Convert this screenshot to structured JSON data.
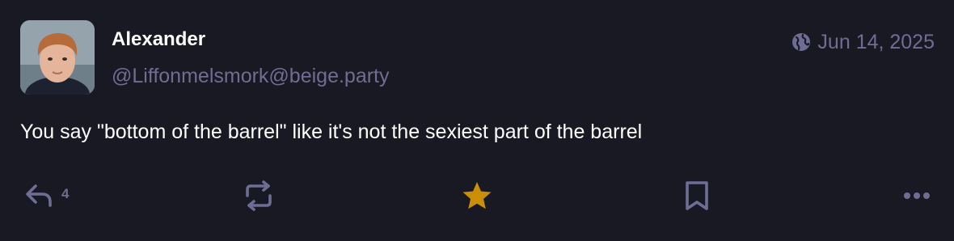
{
  "post": {
    "author": {
      "display_name": "Alexander",
      "handle": "@Liffonmelsmork@beige.party",
      "avatar_icon": "child-portrait-avatar"
    },
    "visibility_icon": "globe-icon",
    "date": "Jun 14, 2025",
    "content": "You say \"bottom of the barrel\" like it's not the sexiest part of the barrel",
    "actions": {
      "reply_count": "4",
      "favourited": true
    }
  },
  "colors": {
    "background": "#191923",
    "text_primary": "#ffffff",
    "text_muted": "#6f6d94",
    "favourite_active": "#ca8f04"
  }
}
